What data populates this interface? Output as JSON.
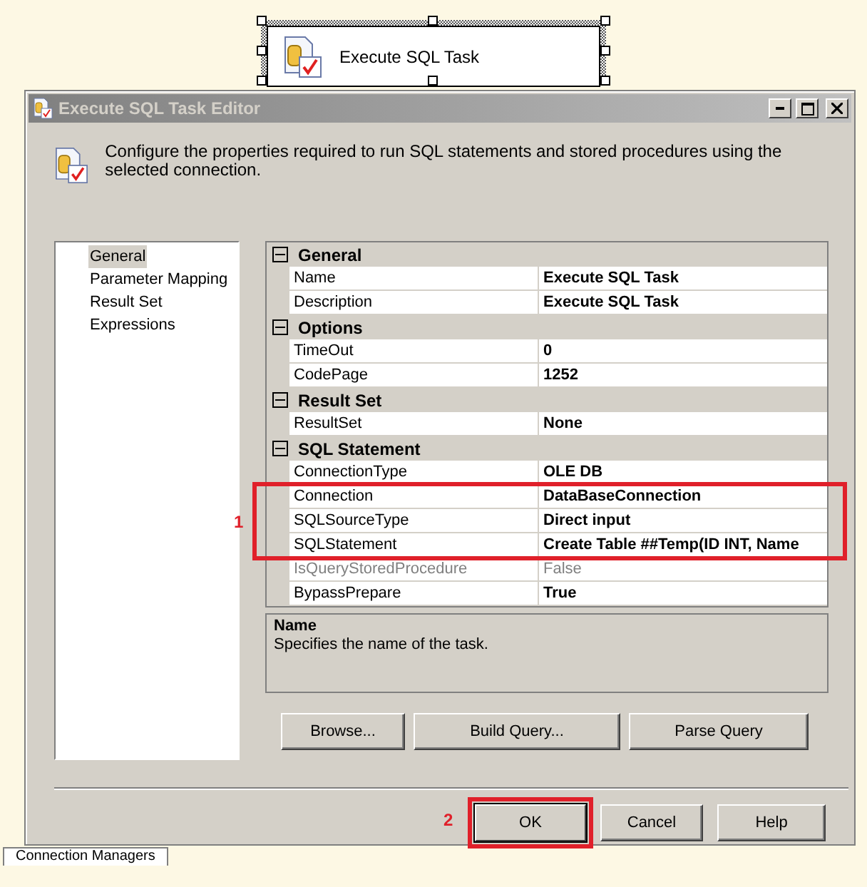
{
  "canvas": {
    "task": {
      "label": "Execute SQL Task",
      "selected": true
    },
    "bottom_tab": "Connection Managers"
  },
  "dialog": {
    "title": "Execute SQL Task Editor",
    "description": "Configure the properties required to run SQL statements and stored procedures using the selected connection.",
    "pages": [
      {
        "label": "General",
        "selected": true
      },
      {
        "label": "Parameter Mapping",
        "selected": false
      },
      {
        "label": "Result Set",
        "selected": false
      },
      {
        "label": "Expressions",
        "selected": false
      }
    ],
    "property_groups": [
      {
        "name": "General",
        "expanded": true,
        "properties": [
          {
            "kind": "property",
            "name": "Name",
            "value": "Execute SQL Task",
            "disabled": false
          },
          {
            "kind": "property",
            "name": "Description",
            "value": "Execute SQL Task",
            "disabled": false
          }
        ]
      },
      {
        "name": "Options",
        "expanded": true,
        "properties": [
          {
            "kind": "property",
            "name": "TimeOut",
            "value": "0",
            "disabled": false
          },
          {
            "kind": "property",
            "name": "CodePage",
            "value": "1252",
            "disabled": false
          }
        ]
      },
      {
        "name": "Result Set",
        "expanded": true,
        "properties": [
          {
            "kind": "property",
            "name": "ResultSet",
            "value": "None",
            "disabled": false
          }
        ]
      },
      {
        "name": "SQL Statement",
        "expanded": true,
        "properties": [
          {
            "kind": "property",
            "name": "ConnectionType",
            "value": "OLE DB",
            "disabled": false
          },
          {
            "kind": "highlight",
            "label": "1",
            "properties": [
              {
                "name": "Connection",
                "value": "DataBaseConnection",
                "disabled": false
              },
              {
                "name": "SQLSourceType",
                "value": "Direct input",
                "disabled": false
              },
              {
                "name": "SQLStatement",
                "value": "Create Table ##Temp(ID INT, Name",
                "disabled": false
              }
            ]
          },
          {
            "kind": "property",
            "name": "IsQueryStoredProcedure",
            "value": "False",
            "disabled": true
          },
          {
            "kind": "property",
            "name": "BypassPrepare",
            "value": "True",
            "disabled": false
          }
        ]
      }
    ],
    "help": {
      "title": "Name",
      "text": "Specifies the name of the task."
    },
    "query_buttons": [
      "Browse...",
      "Build Query...",
      "Parse Query"
    ],
    "buttons": [
      {
        "label": "OK",
        "default": true,
        "annotation": "2"
      },
      {
        "label": "Cancel",
        "default": false
      },
      {
        "label": "Help",
        "default": false
      }
    ]
  }
}
